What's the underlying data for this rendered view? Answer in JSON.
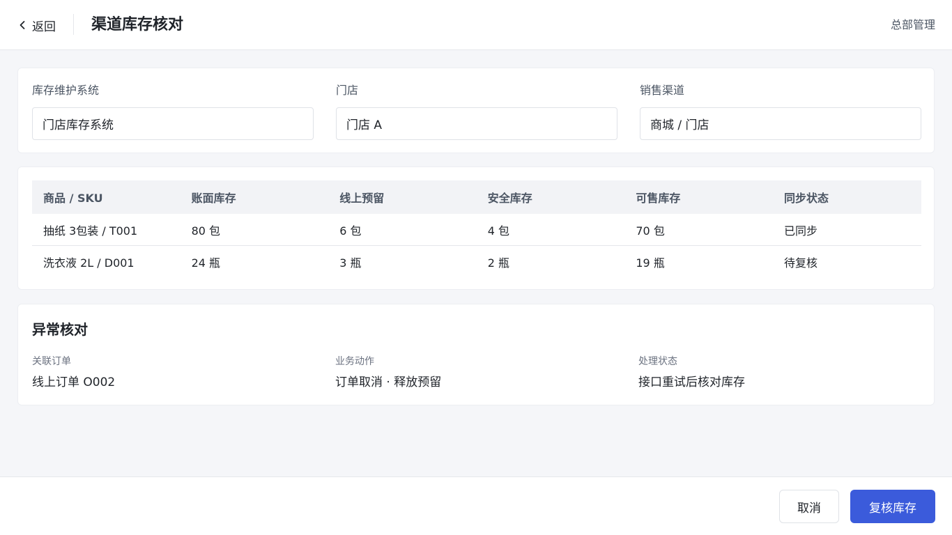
{
  "header": {
    "back_label": "返回",
    "title": "渠道库存核对",
    "right_label": "总部管理"
  },
  "filters": [
    {
      "label": "库存维护系统",
      "value": "门店库存系统"
    },
    {
      "label": "门店",
      "value": "门店 A"
    },
    {
      "label": "销售渠道",
      "value": "商城 / 门店"
    }
  ],
  "table": {
    "columns": [
      "商品 / SKU",
      "账面库存",
      "线上预留",
      "安全库存",
      "可售库存",
      "同步状态"
    ],
    "rows": [
      [
        "抽纸 3包装 / T001",
        "80 包",
        "6 包",
        "4 包",
        "70 包",
        "已同步"
      ],
      [
        "洗衣液 2L / D001",
        "24 瓶",
        "3 瓶",
        "2 瓶",
        "19 瓶",
        "待复核"
      ]
    ]
  },
  "exception": {
    "title": "异常核对",
    "items": [
      {
        "label": "关联订单",
        "value": "线上订单 O002"
      },
      {
        "label": "业务动作",
        "value": "订单取消 · 释放预留"
      },
      {
        "label": "处理状态",
        "value": "接口重试后核对库存"
      }
    ]
  },
  "footer": {
    "cancel_label": "取消",
    "primary_label": "复核库存"
  },
  "icons": {
    "back": "chevron-left-icon"
  },
  "colors": {
    "primary": "#3b5bdb",
    "background": "#f5f6f9"
  }
}
